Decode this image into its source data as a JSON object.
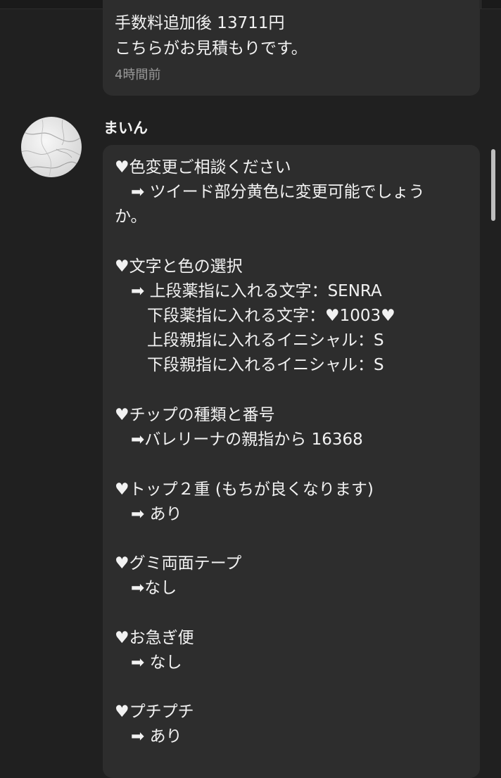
{
  "previous_message": {
    "lines": [
      "手数料追加後 13711円",
      "こちらがお見積もりです。"
    ],
    "time": "4時間前"
  },
  "message": {
    "sender": "まいん",
    "lines": [
      "♥色変更ご相談ください",
      "　➡ ツイード部分黄色に変更可能でしょう",
      "か。",
      "♥文字と色の選択",
      "　➡ 上段薬指に入れる文字：SENRA",
      "　　下段薬指に入れる文字：♥1003♥",
      "　　上段親指に入れるイニシャル：S",
      "　　下段親指に入れるイニシャル：S",
      "♥チップの種類と番号",
      "　➡バレリーナの親指から 16368",
      "♥トップ２重 (もちが良くなります)",
      "　➡ あり",
      "♥グミ両面テープ",
      "　➡なし",
      "♥お急ぎ便",
      "　➡ なし",
      "♥プチプチ",
      "　➡ あり"
    ]
  },
  "colors": {
    "background": "#202020",
    "bubble": "#2d2d2d",
    "text": "#f2f2f2",
    "time_text": "#9a9a9a"
  }
}
